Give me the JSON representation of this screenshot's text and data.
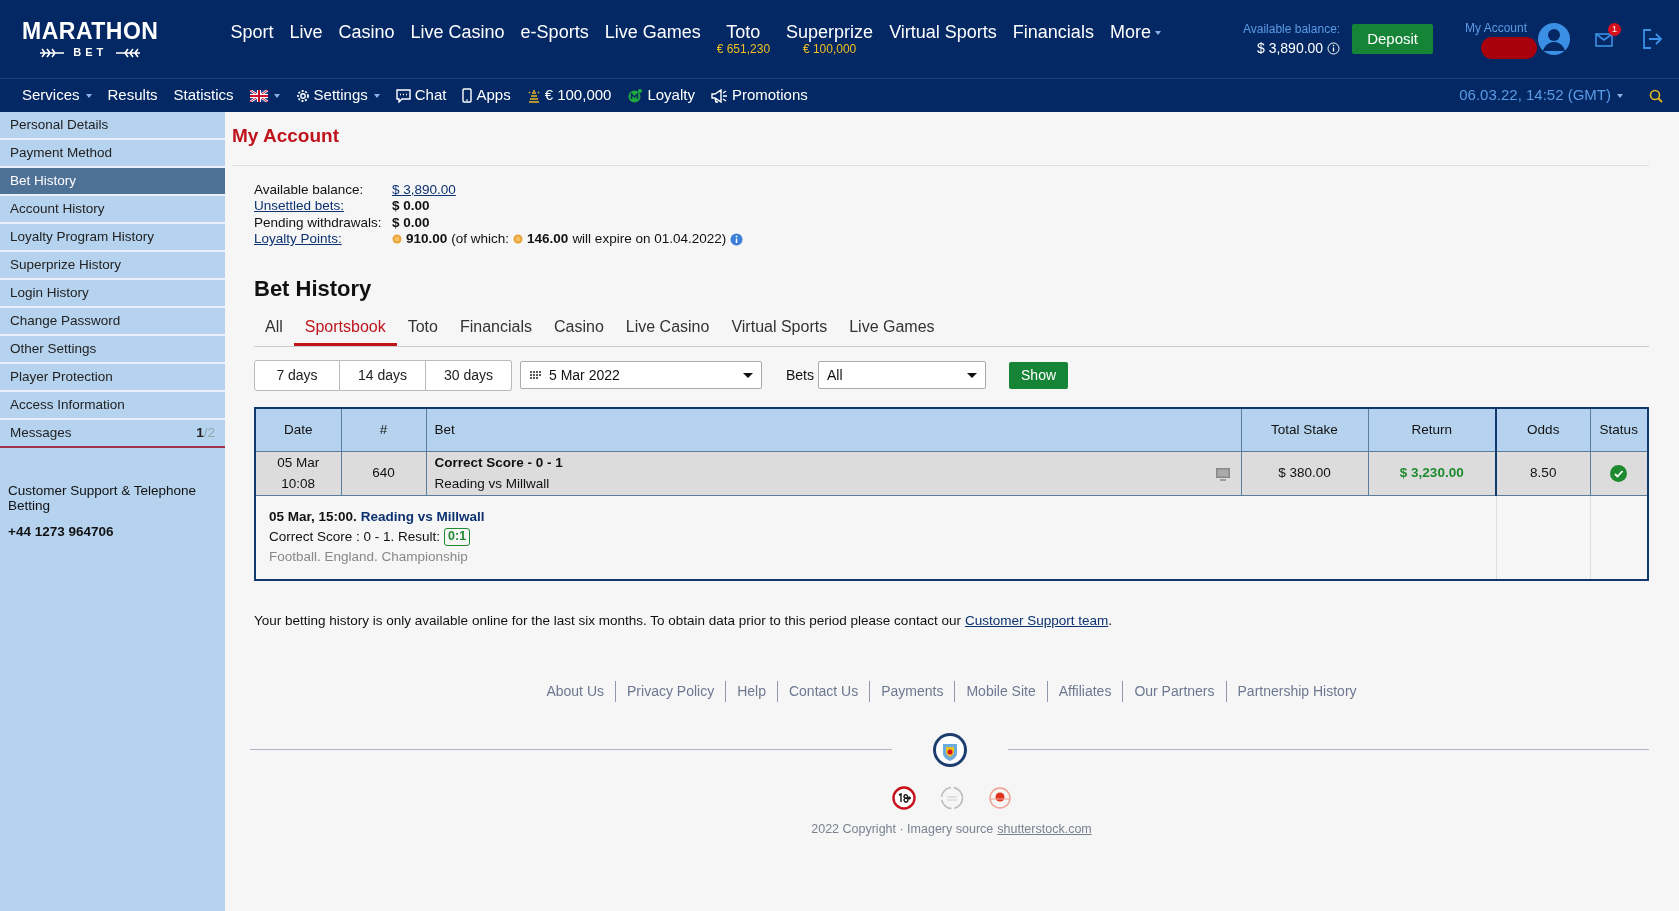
{
  "brand": {
    "name": "MARATHON",
    "sub": "BET"
  },
  "main_nav": [
    {
      "label": "Sport",
      "has_menu": false
    },
    {
      "label": "Live",
      "has_menu": false
    },
    {
      "label": "Casino",
      "has_menu": false
    },
    {
      "label": "Live Casino",
      "has_menu": false
    },
    {
      "label": "e-Sports",
      "has_menu": false
    },
    {
      "label": "Live Games",
      "has_menu": false
    },
    {
      "label": "Toto",
      "sub": "€ 651,230",
      "has_menu": false
    },
    {
      "label": "Superprize",
      "sub": "€ 100,000",
      "has_menu": false
    },
    {
      "label": "Virtual Sports",
      "has_menu": false
    },
    {
      "label": "Financials",
      "has_menu": false
    },
    {
      "label": "More",
      "has_menu": true
    }
  ],
  "balance": {
    "label": "Available balance:",
    "value": "$ 3,890.00"
  },
  "deposit_button": "Deposit",
  "account": {
    "label": "My Account",
    "unread": "1"
  },
  "sub_nav": [
    {
      "label": "Services",
      "kind": "text",
      "has_menu": true
    },
    {
      "label": "Results",
      "kind": "text",
      "has_menu": false
    },
    {
      "label": "Statistics",
      "kind": "text",
      "has_menu": false
    },
    {
      "kind": "flag",
      "has_menu": true
    },
    {
      "label": "Settings",
      "kind": "gear",
      "has_menu": true
    },
    {
      "label": "Chat",
      "kind": "chat",
      "has_menu": false
    },
    {
      "label": "Apps",
      "kind": "phone",
      "has_menu": false
    },
    {
      "label": "€ 100,000",
      "kind": "prize",
      "has_menu": false
    },
    {
      "label": "Loyalty",
      "kind": "loyalty",
      "has_menu": false
    },
    {
      "label": "Promotions",
      "kind": "megaphone",
      "has_menu": false
    }
  ],
  "clock": "06.03.22, 14:52 (GMT)",
  "sidebar": {
    "items": [
      {
        "label": "Personal Details",
        "selected": false
      },
      {
        "label": "Payment Method",
        "selected": false
      },
      {
        "label": "Bet History",
        "selected": true
      },
      {
        "label": "Account History",
        "selected": false
      },
      {
        "label": "Loyalty Program History",
        "selected": false
      },
      {
        "label": "Superprize History",
        "selected": false
      },
      {
        "label": "Login History",
        "selected": false
      },
      {
        "label": "Change Password",
        "selected": false
      },
      {
        "label": "Other Settings",
        "selected": false
      },
      {
        "label": "Player Protection",
        "selected": false
      },
      {
        "label": "Access Information",
        "selected": false
      },
      {
        "label": "Messages",
        "selected": false,
        "count": "1",
        "total": "/2"
      }
    ],
    "support_label": "Customer Support & Telephone Betting",
    "support_phone": "+44 1273 964706"
  },
  "page_title": "My Account",
  "summary": [
    {
      "label": "Available balance:",
      "label_link": false,
      "value": "$ 3,890.00",
      "kind": "link"
    },
    {
      "label": "Unsettled bets:",
      "label_link": true,
      "value": "$ 0.00",
      "kind": "bold"
    },
    {
      "label": "Pending withdrawals:",
      "label_link": false,
      "value": "$ 0.00",
      "kind": "bold"
    },
    {
      "label": "Loyalty Points:",
      "label_link": true,
      "kind": "points",
      "points": "910.00",
      "note_before": "(of which:",
      "expiring": "146.00",
      "note_after": "will expire on 01.04.2022)"
    }
  ],
  "section_title": "Bet History",
  "tabs": [
    {
      "label": "All",
      "selected": false
    },
    {
      "label": "Sportsbook",
      "selected": true
    },
    {
      "label": "Toto",
      "selected": false
    },
    {
      "label": "Financials",
      "selected": false
    },
    {
      "label": "Casino",
      "selected": false
    },
    {
      "label": "Live Casino",
      "selected": false
    },
    {
      "label": "Virtual Sports",
      "selected": false
    },
    {
      "label": "Live Games",
      "selected": false
    }
  ],
  "periods": [
    {
      "label": "7 days",
      "selected": false
    },
    {
      "label": "14 days",
      "selected": false
    },
    {
      "label": "30 days",
      "selected": false
    }
  ],
  "date_select": "5 Mar 2022",
  "bets_label": "Bets",
  "bets_select": "All",
  "show_button": "Show",
  "table": {
    "columns": [
      "Date",
      "#",
      "Bet",
      "Total Stake",
      "Return",
      "Odds",
      "Status"
    ],
    "rows": [
      {
        "date": "05 Mar",
        "time": "10:08",
        "number": "640",
        "bet": "Correct Score - 0 - 1",
        "event": "Reading vs Millwall",
        "total_stake": "$ 380.00",
        "return": "$ 3,230.00",
        "odds": "8.50",
        "won": true,
        "details": {
          "when": "05 Mar, 15:00.",
          "match": "Reading vs Millwall",
          "market": "Correct Score : 0 - 1. Result:",
          "result": "0:1",
          "league": "Football. England. Championship"
        }
      }
    ]
  },
  "note": {
    "text": "Your betting history is only available online for the last six months. To obtain data prior to this period please contact our",
    "link": "Customer Support team",
    "end": "."
  },
  "footer": {
    "links": [
      "About Us",
      "Privacy Policy",
      "Help",
      "Contact Us",
      "Payments",
      "Mobile Site",
      "Affiliates",
      "Our Partners",
      "Partnership History"
    ],
    "copyright": "2022 Copyright · Imagery source",
    "source_link": "shutterstock.com"
  }
}
